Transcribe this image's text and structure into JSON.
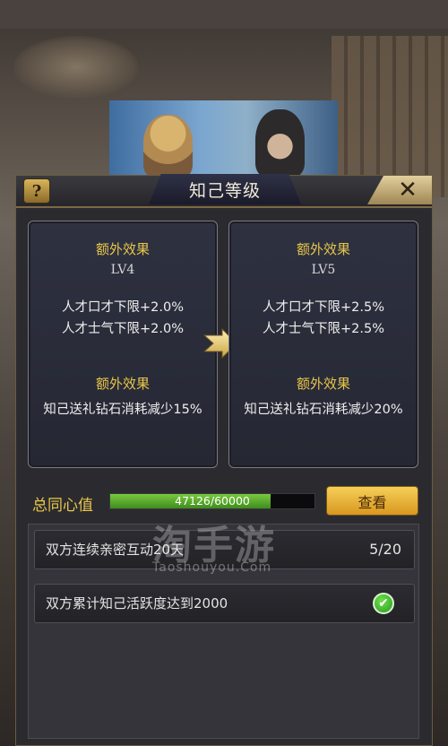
{
  "panel": {
    "title": "知己等级",
    "help_label": "?",
    "close_label": "✕"
  },
  "levels": {
    "current": {
      "extra_label_top": "额外效果",
      "level": "LV4",
      "effect_1": "人才口才下限+2.0%",
      "effect_2": "人才士气下限+2.0%",
      "extra_label_bottom": "额外效果",
      "bonus": "知己送礼钻石消耗减少15%"
    },
    "next": {
      "extra_label_top": "额外效果",
      "level": "LV5",
      "effect_1": "人才口才下限+2.5%",
      "effect_2": "人才士气下限+2.5%",
      "extra_label_bottom": "额外效果",
      "bonus": "知己送礼钻石消耗减少20%"
    }
  },
  "progress": {
    "label": "总同心值",
    "text": "47126/60000",
    "value": 47126,
    "max": 60000,
    "fill_color": "#5aab2e"
  },
  "view_button": "查看",
  "tasks": [
    {
      "text": "双方连续亲密互动20天",
      "progress": "5/20",
      "done": false
    },
    {
      "text": "双方累计知己活跃度达到2000",
      "progress": "",
      "done": true
    }
  ],
  "check_icon": "✔",
  "watermark": {
    "main": "淘手游",
    "sub": "Taoshouyou.Com"
  },
  "colors": {
    "gold": "#e8c64a",
    "panel_bg": "#2b2b2f"
  }
}
